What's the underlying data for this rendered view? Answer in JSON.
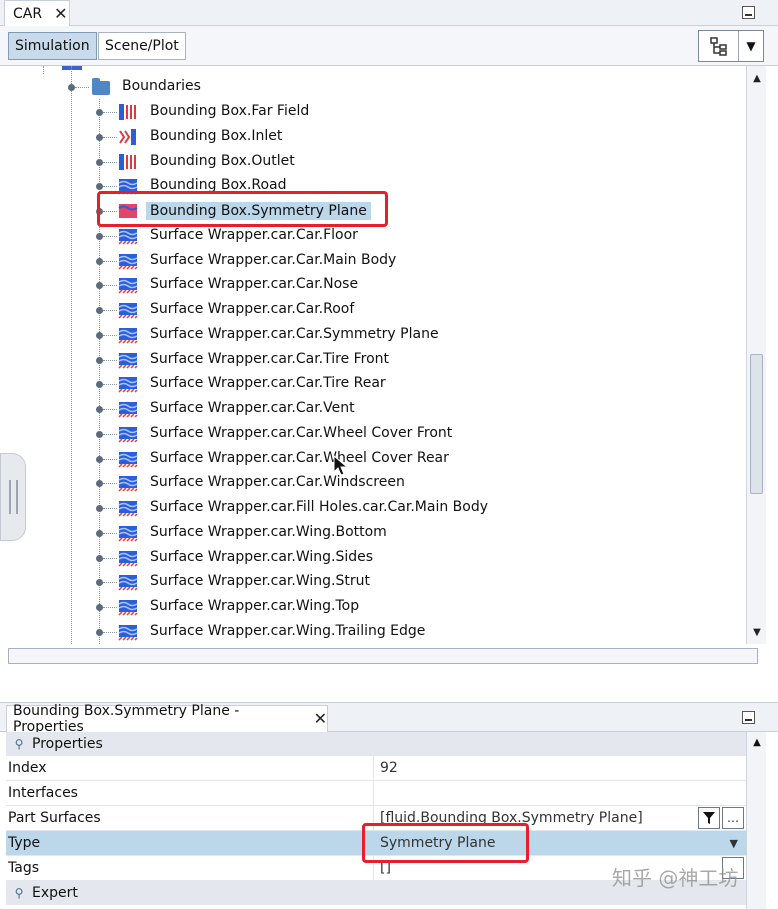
{
  "window": {
    "tab_label": "CAR",
    "subtabs": [
      "Simulation",
      "Scene/Plot"
    ]
  },
  "tree": {
    "folder_label": "Boundaries",
    "items": [
      {
        "label": "Bounding Box.Far Field",
        "icon": "freestream-boundary-icon"
      },
      {
        "label": "Bounding Box.Inlet",
        "icon": "inlet-boundary-icon"
      },
      {
        "label": "Bounding Box.Outlet",
        "icon": "outlet-boundary-icon"
      },
      {
        "label": "Bounding Box.Road",
        "icon": "wall-boundary-icon"
      },
      {
        "label": "Bounding Box.Symmetry Plane",
        "icon": "symmetry-boundary-icon",
        "selected": true
      },
      {
        "label": "Surface Wrapper.car.Car.Floor",
        "icon": "wall-boundary-icon"
      },
      {
        "label": "Surface Wrapper.car.Car.Main Body",
        "icon": "wall-boundary-icon"
      },
      {
        "label": "Surface Wrapper.car.Car.Nose",
        "icon": "wall-boundary-icon"
      },
      {
        "label": "Surface Wrapper.car.Car.Roof",
        "icon": "wall-boundary-icon"
      },
      {
        "label": "Surface Wrapper.car.Car.Symmetry Plane",
        "icon": "wall-boundary-icon"
      },
      {
        "label": "Surface Wrapper.car.Car.Tire Front",
        "icon": "wall-boundary-icon"
      },
      {
        "label": "Surface Wrapper.car.Car.Tire Rear",
        "icon": "wall-boundary-icon"
      },
      {
        "label": "Surface Wrapper.car.Car.Vent",
        "icon": "wall-boundary-icon"
      },
      {
        "label": "Surface Wrapper.car.Car.Wheel Cover Front",
        "icon": "wall-boundary-icon"
      },
      {
        "label": "Surface Wrapper.car.Car.Wheel Cover Rear",
        "icon": "wall-boundary-icon"
      },
      {
        "label": "Surface Wrapper.car.Car.Windscreen",
        "icon": "wall-boundary-icon"
      },
      {
        "label": "Surface Wrapper.car.Fill Holes.car.Car.Main Body",
        "icon": "wall-boundary-icon"
      },
      {
        "label": "Surface Wrapper.car.Wing.Bottom",
        "icon": "wall-boundary-icon"
      },
      {
        "label": "Surface Wrapper.car.Wing.Sides",
        "icon": "wall-boundary-icon"
      },
      {
        "label": "Surface Wrapper.car.Wing.Strut",
        "icon": "wall-boundary-icon"
      },
      {
        "label": "Surface Wrapper.car.Wing.Top",
        "icon": "wall-boundary-icon"
      },
      {
        "label": "Surface Wrapper.car.Wing.Trailing Edge",
        "icon": "wall-boundary-icon"
      }
    ]
  },
  "properties": {
    "tab_label": "Bounding Box.Symmetry Plane - Properties",
    "section_properties": "Properties",
    "section_expert": "Expert",
    "rows": [
      {
        "key": "Index",
        "value": "92"
      },
      {
        "key": "Interfaces",
        "value": ""
      },
      {
        "key": "Part Surfaces",
        "value": "[fluid.Bounding Box.Symmetry Plane]"
      },
      {
        "key": "Type",
        "value": "Symmetry Plane"
      },
      {
        "key": "Tags",
        "value": "[]"
      }
    ]
  },
  "watermark": "知乎 @神工坊",
  "colors": {
    "selection": "#bcd7ea",
    "highlight_box": "#e5202a",
    "wall_icon_blue": "#2b5fd9",
    "wall_icon_red": "#e23a3a"
  }
}
